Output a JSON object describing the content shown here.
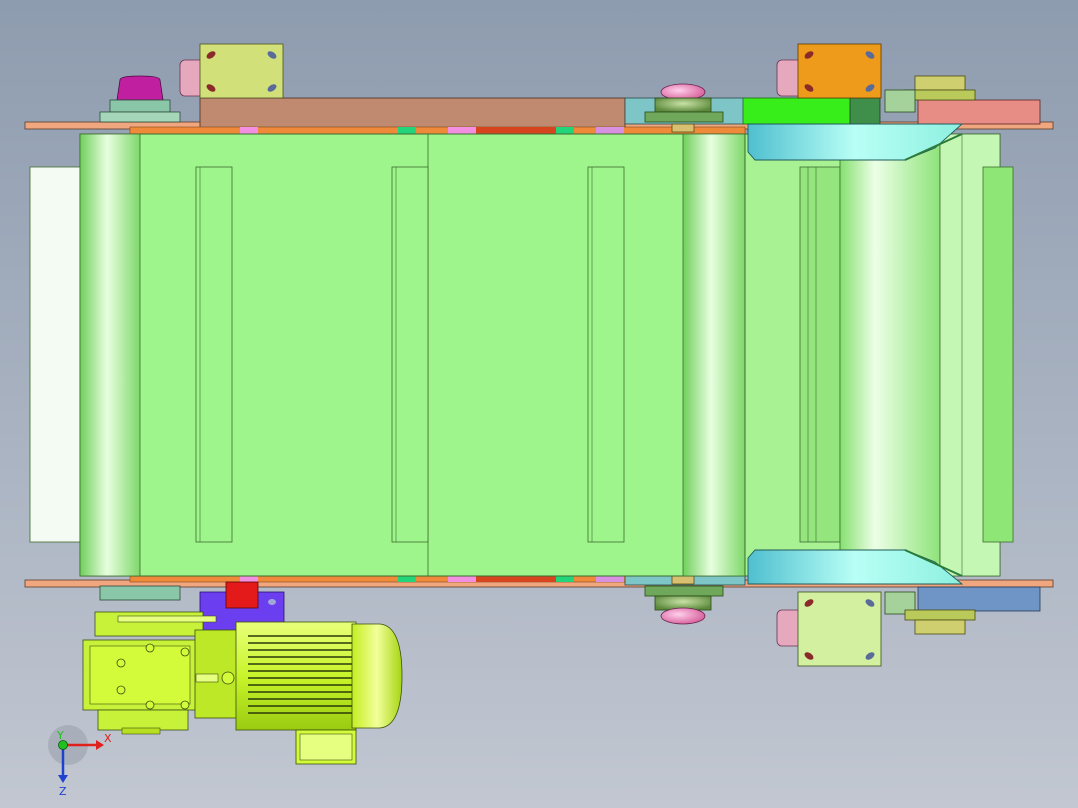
{
  "viewport": {
    "background": "cad-gradient-gray-blue",
    "model": "belt-conveyor-with-geared-motor"
  },
  "triad": {
    "x_label": "X",
    "y_label": "Y",
    "z_label": "Z",
    "x_color": "#e0201c",
    "y_color": "#1fc021",
    "z_color": "#2040d0"
  },
  "colors": {
    "belt": "#9ef58b",
    "belt_edge": "#3c6b2f",
    "motor": "#d4fb3a",
    "frame_top": "#c08a70",
    "bracket_yellow": "#d2e07a",
    "bracket_orange": "#ee9a1a",
    "bearing_pink": "#e890c0",
    "bearing_magenta": "#c020a0",
    "blue_bar": "#6e95c5",
    "cyan_chute": "#7fe3e0",
    "bright_green": "#38ee1a",
    "purple_plate": "#6b3ff0",
    "red_block": "#e41a1a"
  }
}
